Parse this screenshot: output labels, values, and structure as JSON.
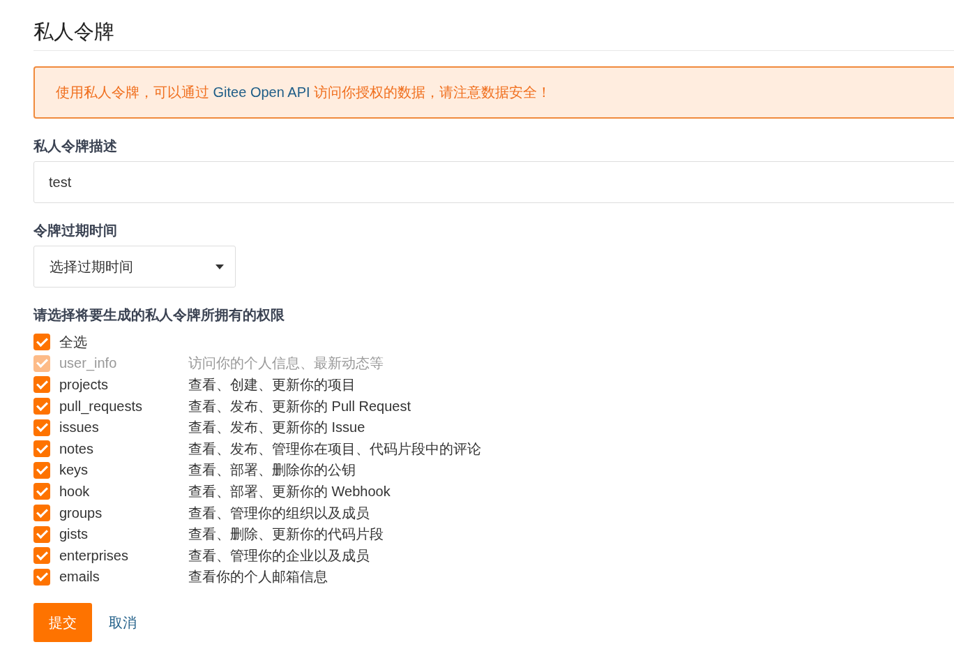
{
  "page_title": "私人令牌",
  "notice": {
    "before": "使用私人令牌，可以通过 ",
    "link": "Gitee Open API",
    "after": " 访问你授权的数据，请注意数据安全！"
  },
  "description_field": {
    "label": "私人令牌描述",
    "value": "test"
  },
  "expiry_field": {
    "label": "令牌过期时间",
    "value": "选择过期时间"
  },
  "permissions": {
    "label": "请选择将要生成的私人令牌所拥有的权限",
    "select_all": {
      "label": "全选",
      "checked": true,
      "disabled": false
    },
    "items": [
      {
        "name": "user_info",
        "description": "访问你的个人信息、最新动态等",
        "checked": true,
        "disabled": true
      },
      {
        "name": "projects",
        "description": "查看、创建、更新你的项目",
        "checked": true,
        "disabled": false
      },
      {
        "name": "pull_requests",
        "description": "查看、发布、更新你的 Pull Request",
        "checked": true,
        "disabled": false
      },
      {
        "name": "issues",
        "description": "查看、发布、更新你的 Issue",
        "checked": true,
        "disabled": false
      },
      {
        "name": "notes",
        "description": "查看、发布、管理你在项目、代码片段中的评论",
        "checked": true,
        "disabled": false
      },
      {
        "name": "keys",
        "description": "查看、部署、删除你的公钥",
        "checked": true,
        "disabled": false
      },
      {
        "name": "hook",
        "description": "查看、部署、更新你的 Webhook",
        "checked": true,
        "disabled": false
      },
      {
        "name": "groups",
        "description": "查看、管理你的组织以及成员",
        "checked": true,
        "disabled": false
      },
      {
        "name": "gists",
        "description": "查看、删除、更新你的代码片段",
        "checked": true,
        "disabled": false
      },
      {
        "name": "enterprises",
        "description": "查看、管理你的企业以及成员",
        "checked": true,
        "disabled": false
      },
      {
        "name": "emails",
        "description": "查看你的个人邮箱信息",
        "checked": true,
        "disabled": false
      }
    ]
  },
  "buttons": {
    "submit": "提交",
    "cancel": "取消"
  }
}
